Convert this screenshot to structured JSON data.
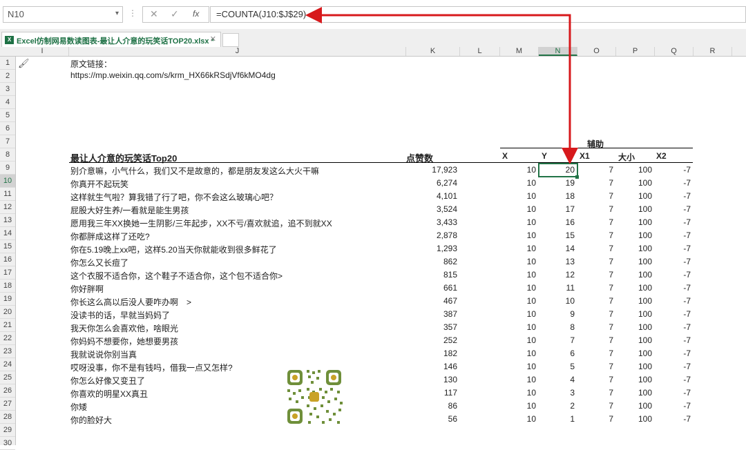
{
  "formula_bar": {
    "name_box": "N10",
    "name_box_arrow": "▾",
    "separator": "⋮",
    "cancel": "✕",
    "enter": "✓",
    "fx": "fx",
    "formula": "=COUNTA(J10:$J$29)"
  },
  "tab": {
    "title": "Excel仿制网易数读图表-最让人介意的玩笑话TOP20.xlsx *",
    "icon": "X",
    "close": "✕"
  },
  "columns": [
    "I",
    "J",
    "K",
    "L",
    "M",
    "N",
    "O",
    "P",
    "Q",
    "R"
  ],
  "active_column": "N",
  "rows": [
    "1",
    "2",
    "3",
    "4",
    "5",
    "6",
    "7",
    "8",
    "9",
    "10",
    "11",
    "12",
    "13",
    "14",
    "15",
    "16",
    "17",
    "18",
    "19",
    "20",
    "21",
    "22",
    "23",
    "24",
    "25",
    "26",
    "27",
    "28",
    "29",
    "30"
  ],
  "active_row": "10",
  "source": {
    "label": "原文链接：",
    "url": "https://mp.weixin.qq.com/s/krm_HX66kRSdjVf6kMO4dg"
  },
  "table": {
    "aux_label": "辅助",
    "header_title": "最让人介意的玩笑话Top20",
    "header_likes": "点赞数",
    "header_x": "X",
    "header_y": "Y",
    "header_x1": "X1",
    "header_size": "大小",
    "header_x2": "X2",
    "rows": [
      {
        "text": "别介意嘛，小气什么，我们又不是故意的，都是朋友发这么大火干嘛",
        "likes": "17,923",
        "x": "10",
        "y": "20",
        "x1": "7",
        "size": "100",
        "x2": "-7"
      },
      {
        "text": "你真开不起玩笑",
        "likes": "6,274",
        "x": "10",
        "y": "19",
        "x1": "7",
        "size": "100",
        "x2": "-7"
      },
      {
        "text": "这样就生气啦？算我错了行了吧，你不会这么玻璃心吧？",
        "likes": "4,101",
        "x": "10",
        "y": "18",
        "x1": "7",
        "size": "100",
        "x2": "-7"
      },
      {
        "text": "屁股大好生养/一看就是能生男孩",
        "likes": "3,524",
        "x": "10",
        "y": "17",
        "x1": "7",
        "size": "100",
        "x2": "-7"
      },
      {
        "text": "愿用我三年XX换她一生阴影/三年起步，XX不亏/喜欢就追，追不到就XX",
        "likes": "3,433",
        "x": "10",
        "y": "16",
        "x1": "7",
        "size": "100",
        "x2": "-7"
      },
      {
        "text": "你都胖成这样了还吃?",
        "likes": "2,878",
        "x": "10",
        "y": "15",
        "x1": "7",
        "size": "100",
        "x2": "-7"
      },
      {
        "text": "你在5.19晚上xx吧，这样5.20当天你就能收到很多鲜花了",
        "likes": "1,293",
        "x": "10",
        "y": "14",
        "x1": "7",
        "size": "100",
        "x2": "-7"
      },
      {
        "text": "你怎么又长痘了",
        "likes": "862",
        "x": "10",
        "y": "13",
        "x1": "7",
        "size": "100",
        "x2": "-7"
      },
      {
        "text": "这个衣服不适合你，这个鞋子不适合你，这个包不适合你>",
        "likes": "815",
        "x": "10",
        "y": "12",
        "x1": "7",
        "size": "100",
        "x2": "-7"
      },
      {
        "text": "你好胖啊",
        "likes": "661",
        "x": "10",
        "y": "11",
        "x1": "7",
        "size": "100",
        "x2": "-7"
      },
      {
        "text": "你长这么高以后没人要咋办啊　>",
        "likes": "467",
        "x": "10",
        "y": "10",
        "x1": "7",
        "size": "100",
        "x2": "-7"
      },
      {
        "text": "没读书的话，早就当妈妈了",
        "likes": "387",
        "x": "10",
        "y": "9",
        "x1": "7",
        "size": "100",
        "x2": "-7"
      },
      {
        "text": "我天你怎么会喜欢他，啥眼光",
        "likes": "357",
        "x": "10",
        "y": "8",
        "x1": "7",
        "size": "100",
        "x2": "-7"
      },
      {
        "text": "你妈妈不想要你，她想要男孩",
        "likes": "252",
        "x": "10",
        "y": "7",
        "x1": "7",
        "size": "100",
        "x2": "-7"
      },
      {
        "text": "我就说说你别当真",
        "likes": "182",
        "x": "10",
        "y": "6",
        "x1": "7",
        "size": "100",
        "x2": "-7"
      },
      {
        "text": "哎呀没事，你不是有钱吗，借我一点又怎样?",
        "likes": "146",
        "x": "10",
        "y": "5",
        "x1": "7",
        "size": "100",
        "x2": "-7"
      },
      {
        "text": "你怎么好像又变丑了",
        "likes": "130",
        "x": "10",
        "y": "4",
        "x1": "7",
        "size": "100",
        "x2": "-7"
      },
      {
        "text": "你喜欢的明星XX真丑",
        "likes": "117",
        "x": "10",
        "y": "3",
        "x1": "7",
        "size": "100",
        "x2": "-7"
      },
      {
        "text": "你矮",
        "likes": "86",
        "x": "10",
        "y": "2",
        "x1": "7",
        "size": "100",
        "x2": "-7"
      },
      {
        "text": "你的脸好大",
        "likes": "56",
        "x": "10",
        "y": "1",
        "x1": "7",
        "size": "100",
        "x2": "-7"
      }
    ]
  },
  "colors": {
    "excel_green": "#217346",
    "annotation_red": "#d7191c"
  },
  "icons": {
    "qr": "qr-code-icon",
    "brush": "format-painter-icon"
  }
}
